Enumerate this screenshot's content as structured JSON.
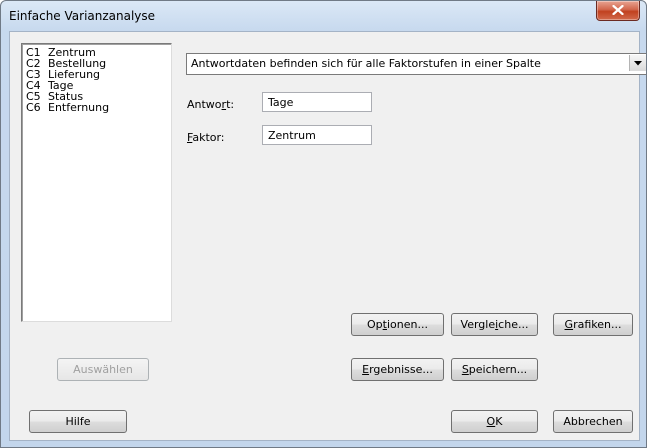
{
  "window": {
    "title": "Einfache Varianzanalyse"
  },
  "columns": [
    {
      "code": "C1",
      "name": "Zentrum"
    },
    {
      "code": "C2",
      "name": "Bestellung"
    },
    {
      "code": "C3",
      "name": "Lieferung"
    },
    {
      "code": "C4",
      "name": "Tage"
    },
    {
      "code": "C5",
      "name": "Status"
    },
    {
      "code": "C6",
      "name": "Entfernung"
    }
  ],
  "data_format": {
    "selected": "Antwortdaten befinden sich für alle Faktorstufen in einer Spalte"
  },
  "response": {
    "label_pre": "Antwo",
    "label_key": "r",
    "label_post": "t:",
    "value": "Tage"
  },
  "factor": {
    "label_key": "F",
    "label_post": "aktor:",
    "value": "Zentrum"
  },
  "buttons": {
    "options": {
      "pre": "Op",
      "key": "t",
      "post": "ionen..."
    },
    "comparisons": {
      "pre": "Vergle",
      "key": "i",
      "post": "che..."
    },
    "graphs": {
      "pre": "",
      "key": "G",
      "post": "rafiken..."
    },
    "results": {
      "pre": "",
      "key": "E",
      "post": "rgebnisse..."
    },
    "storage": {
      "pre": "",
      "key": "S",
      "post": "peichern..."
    },
    "select": "Auswählen",
    "help": "Hilfe",
    "ok": {
      "pre": "",
      "key": "O",
      "post": "K"
    },
    "cancel": "Abbrechen"
  }
}
